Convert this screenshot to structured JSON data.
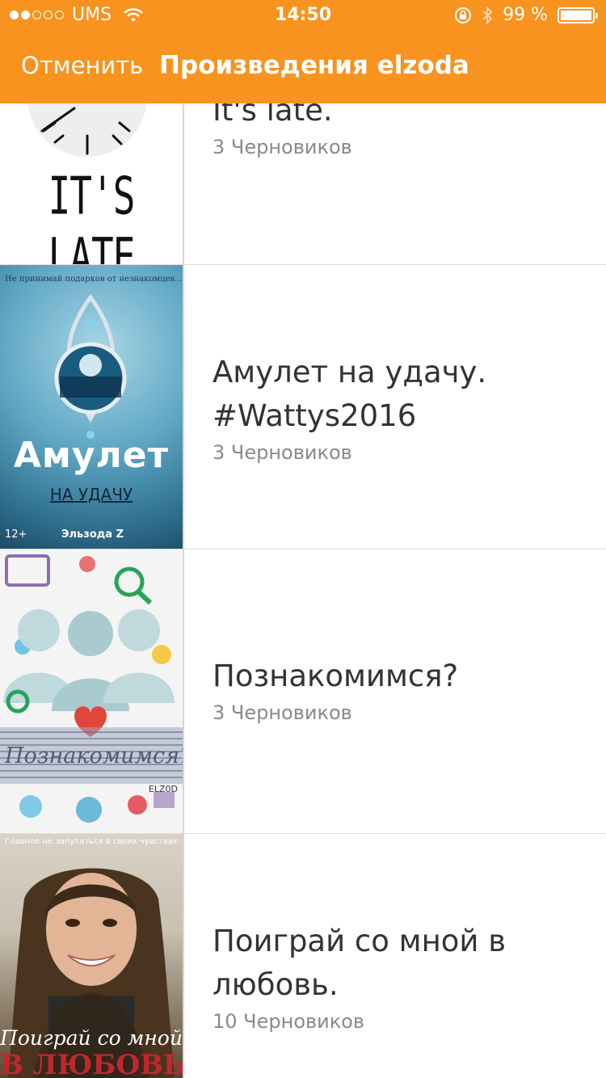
{
  "status_bar": {
    "carrier": "UMS",
    "time": "14:50",
    "battery": "99 %",
    "battery_level": 0.99,
    "signal_bars_filled": 2,
    "signal_bars_total": 5
  },
  "nav": {
    "cancel_label": "Отменить",
    "title": "Произведения elzoda"
  },
  "colors": {
    "accent": "#f7931e"
  },
  "stories": [
    {
      "title": "It's late.",
      "drafts": "3 Черновиков",
      "cover_text": "IT'S LATE"
    },
    {
      "title": "Амулет на удачу. #Wattys2016",
      "drafts": "3 Черновиков",
      "cover_tagline": "Не принимай подарков от незнакомцев...",
      "cover_title": "Амулет",
      "cover_subtitle": "НА УДАЧУ",
      "cover_age": "12+",
      "cover_author": "Эльзода Z"
    },
    {
      "title": "Познакомимся?",
      "drafts": "3 Черновиков",
      "cover_title": "Познакомимся?",
      "cover_author": "ELZ0D"
    },
    {
      "title": "Поиграй со мной в любовь.",
      "drafts": "10 Черновиков",
      "cover_tagline": "Главное не запутаться в своих чувствах",
      "cover_title_line1": "Поиграй со мной",
      "cover_title_line2": "В ЛЮБОВЬ"
    }
  ]
}
